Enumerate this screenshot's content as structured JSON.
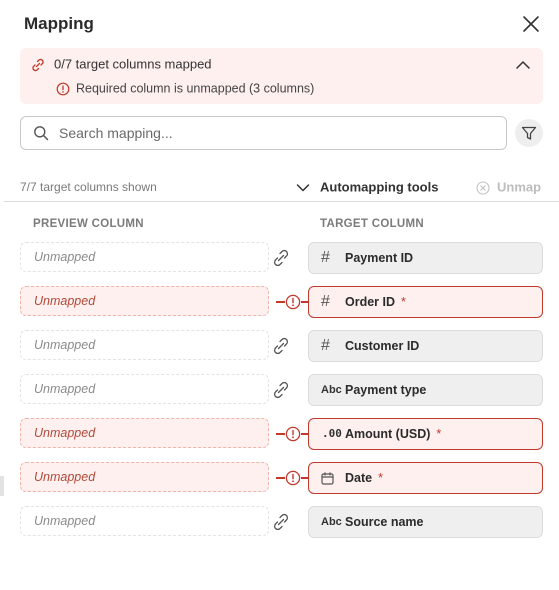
{
  "header": {
    "title": "Mapping"
  },
  "alert": {
    "summary": "0/7 target columns mapped",
    "detail": "Required column is unmapped (3 columns)"
  },
  "search": {
    "placeholder": "Search mapping..."
  },
  "toolbar": {
    "shown_count": "7/7 target columns shown",
    "automapping_label": "Automapping tools",
    "unmap_label": "Unmap"
  },
  "columns": {
    "preview_header": "PREVIEW COLUMN",
    "target_header": "TARGET COLUMN"
  },
  "rows": [
    {
      "preview": "Unmapped",
      "type_icon": "#",
      "target": "Payment ID",
      "required": false
    },
    {
      "preview": "Unmapped",
      "type_icon": "#",
      "target": "Order ID",
      "required": true,
      "marker": "*"
    },
    {
      "preview": "Unmapped",
      "type_icon": "#",
      "target": "Customer ID",
      "required": false
    },
    {
      "preview": "Unmapped",
      "type_icon": "Abc",
      "target": "Payment type",
      "required": false
    },
    {
      "preview": "Unmapped",
      "type_icon": ".00",
      "target": "Amount (USD)",
      "required": true,
      "marker": "*"
    },
    {
      "preview": "Unmapped",
      "type_icon": "calendar-icon",
      "target": "Date",
      "required": true,
      "marker": "*"
    },
    {
      "preview": "Unmapped",
      "type_icon": "Abc",
      "target": "Source name",
      "required": false
    }
  ],
  "colors": {
    "error": "#c0392b",
    "alert_bg": "#fdf0ee",
    "target_bg": "#efefef"
  }
}
